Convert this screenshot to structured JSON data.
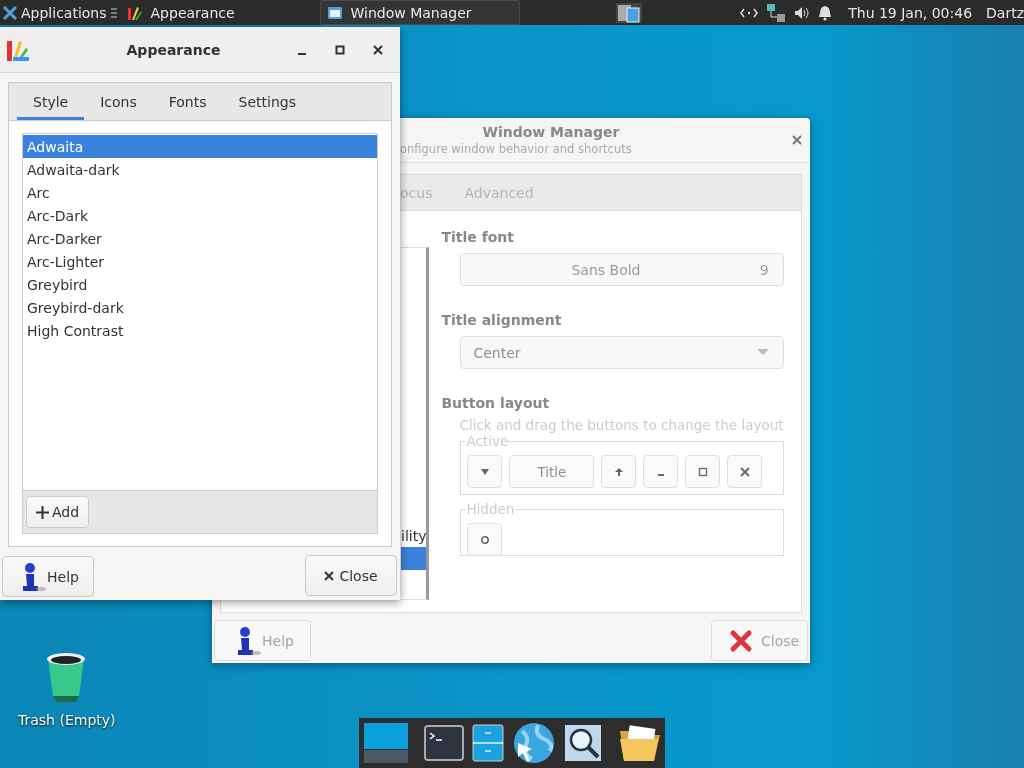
{
  "taskbar": {
    "apps_menu": "Applications",
    "tasks": [
      {
        "label": "Appearance",
        "selected": false
      },
      {
        "label": "Window Manager",
        "selected": true
      }
    ],
    "clock": "Thu 19 Jan, 00:46",
    "user": "Dartz"
  },
  "appearance": {
    "title": "Appearance",
    "tabs": [
      {
        "label": "Style",
        "selected": true
      },
      {
        "label": "Icons",
        "selected": false
      },
      {
        "label": "Fonts",
        "selected": false
      },
      {
        "label": "Settings",
        "selected": false
      }
    ],
    "themes": [
      {
        "name": "Adwaita",
        "selected": true
      },
      {
        "name": "Adwaita-dark",
        "selected": false
      },
      {
        "name": "Arc",
        "selected": false
      },
      {
        "name": "Arc-Dark",
        "selected": false
      },
      {
        "name": "Arc-Darker",
        "selected": false
      },
      {
        "name": "Arc-Lighter",
        "selected": false
      },
      {
        "name": "Greybird",
        "selected": false
      },
      {
        "name": "Greybird-dark",
        "selected": false
      },
      {
        "name": "High Contrast",
        "selected": false
      }
    ],
    "add_button": "Add",
    "help_button": "Help",
    "close_button": "Close"
  },
  "window_manager": {
    "title": "Window Manager",
    "subtitle": "onfigure window behavior and shortcuts",
    "tabs": [
      {
        "label": "ocus",
        "selected": false
      },
      {
        "label": "Advanced",
        "selected": false
      }
    ],
    "list_items": [
      {
        "label": "ility",
        "selected": false
      },
      {
        "selected": true
      }
    ],
    "title_font": {
      "label": "Title font",
      "font": "Sans Bold",
      "size": "9"
    },
    "title_alignment": {
      "label": "Title alignment",
      "value": "Center"
    },
    "button_layout": {
      "label": "Button layout",
      "hint": "Click and drag the buttons to change the layout",
      "active_label": "Active",
      "active_buttons": [
        {
          "kind": "menu"
        },
        {
          "kind": "title",
          "label": "Title"
        },
        {
          "kind": "shade"
        },
        {
          "kind": "minimize"
        },
        {
          "kind": "maximize"
        },
        {
          "kind": "close"
        }
      ],
      "hidden_label": "Hidden",
      "hidden_buttons": [
        {
          "kind": "stick"
        }
      ]
    },
    "help_button": "Help",
    "close_button": "Close"
  },
  "desktop_icons": [
    {
      "label": "Trash (Empty)"
    }
  ],
  "dock": [
    {
      "kind": "workspace"
    },
    {
      "kind": "separator"
    },
    {
      "kind": "terminal"
    },
    {
      "kind": "files"
    },
    {
      "kind": "browser"
    },
    {
      "kind": "search"
    },
    {
      "kind": "separator"
    },
    {
      "kind": "folder"
    }
  ]
}
